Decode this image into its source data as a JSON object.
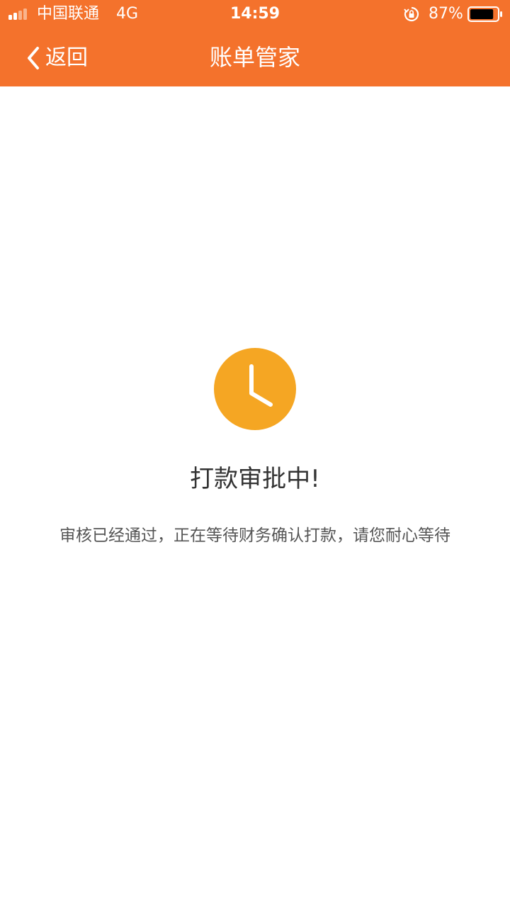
{
  "status_bar": {
    "carrier": "中国联通",
    "network": "4G",
    "time": "14:59",
    "battery_percent": "87%",
    "battery_level": 0.87,
    "icons": [
      "signal-icon",
      "orientation-lock-icon",
      "battery-icon"
    ]
  },
  "nav": {
    "back_label": "返回",
    "title": "账单管家",
    "back_icon": "chevron-left-icon"
  },
  "status": {
    "icon": "clock-icon",
    "title": "打款审批中!",
    "description": "审核已经通过，正在等待财务确认打款，请您耐心等待"
  },
  "colors": {
    "header": "#f4722c",
    "clock": "#f5a623",
    "title_text": "#333333",
    "body_text": "#555555"
  }
}
